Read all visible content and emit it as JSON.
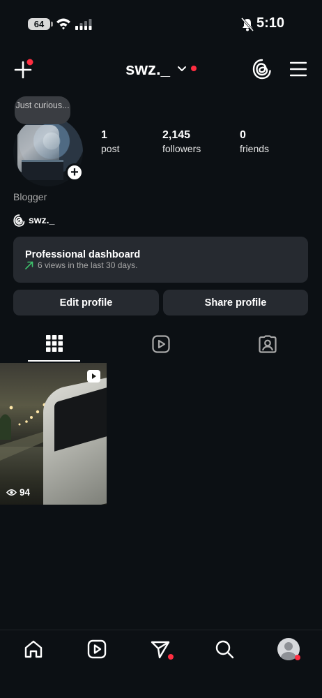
{
  "status_bar": {
    "battery": "64",
    "time": "5:10",
    "icons": [
      "wifi-icon",
      "signal-icon",
      "bell-off-icon"
    ]
  },
  "header": {
    "username": "swz._",
    "icons": [
      "new-post-icon",
      "chevron-down-icon",
      "threads-icon",
      "menu-icon"
    ],
    "notification_color": "#ff2e41"
  },
  "profile": {
    "note": "Just curious...",
    "stats": [
      {
        "value": "1",
        "label": "post"
      },
      {
        "value": "2,145",
        "label": "followers"
      },
      {
        "value": "0",
        "label": "friends"
      }
    ],
    "bio": "Blogger",
    "threads_handle": "swz._"
  },
  "dashboard": {
    "title": "Professional dashboard",
    "subtitle": "6 views in the last 30 days.",
    "accent_color": "#3ec26c"
  },
  "buttons": {
    "edit": "Edit profile",
    "share": "Share profile"
  },
  "tabs": [
    {
      "icon": "grid-icon",
      "selected": true
    },
    {
      "icon": "reels-icon",
      "selected": false
    },
    {
      "icon": "tagged-icon",
      "selected": false
    }
  ],
  "posts": [
    {
      "type": "reel",
      "views": "94"
    }
  ],
  "bottom_nav": {
    "items": [
      "home-icon",
      "reels-icon",
      "send-icon",
      "search-icon",
      "profile-avatar"
    ]
  }
}
